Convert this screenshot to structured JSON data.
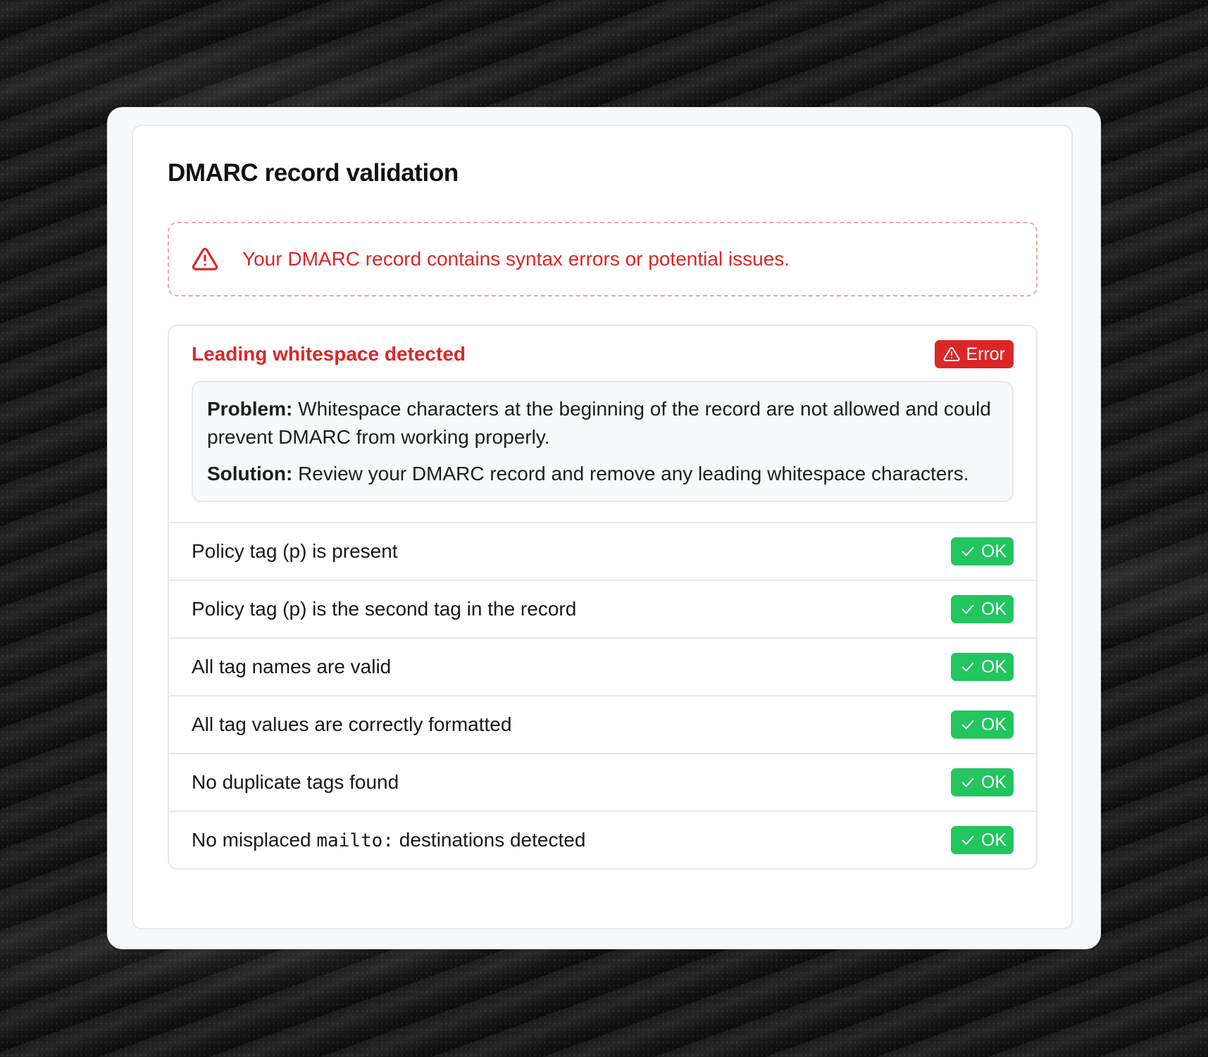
{
  "card": {
    "title": "DMARC record validation"
  },
  "alert": {
    "icon": "warning-triangle-icon",
    "color": "#dc2626",
    "message": "Your DMARC record contains syntax errors or potential issues."
  },
  "error_check": {
    "title": "Leading whitespace detected",
    "badge_label": "Error",
    "badge_icon": "warning-triangle-icon",
    "badge_color": "#dc2626",
    "problem_label": "Problem:",
    "problem_text": " Whitespace characters at the beginning of the record are not allowed and could prevent DMARC from working properly.",
    "solution_label": "Solution:",
    "solution_text": " Review your DMARC record and remove any leading whitespace characters."
  },
  "checks": [
    {
      "pre": "Policy tag (p) is present",
      "code": "",
      "post": "",
      "status": "OK"
    },
    {
      "pre": "Policy tag (p) is the second tag in the record",
      "code": "",
      "post": "",
      "status": "OK"
    },
    {
      "pre": "All tag names are valid",
      "code": "",
      "post": "",
      "status": "OK"
    },
    {
      "pre": "All tag values are correctly formatted",
      "code": "",
      "post": "",
      "status": "OK"
    },
    {
      "pre": "No duplicate tags found",
      "code": "",
      "post": "",
      "status": "OK"
    },
    {
      "pre": "No misplaced ",
      "code": "mailto:",
      "post": " destinations detected",
      "status": "OK"
    }
  ],
  "ok_badge": {
    "icon": "check-icon",
    "color": "#22c55e"
  }
}
